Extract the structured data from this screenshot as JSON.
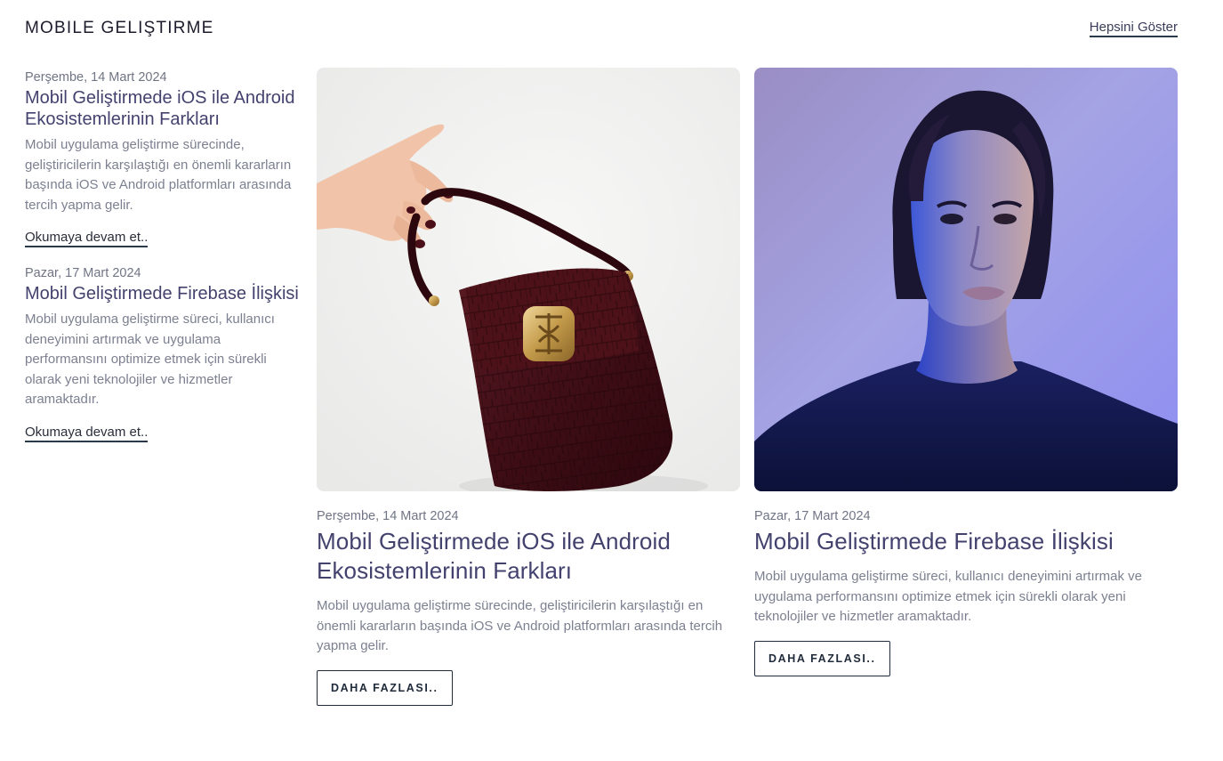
{
  "section": {
    "title": "MOBILE GELIŞTIRME",
    "show_all": "Hepsini Göster"
  },
  "side_posts": [
    {
      "date": "Perşembe, 14 Mart 2024",
      "title": "Mobil Geliştirmede iOS ile Android Ekosistemlerinin Farkları",
      "excerpt": "Mobil uygulama geliştirme sürecinde, geliştiricilerin karşılaştığı en önemli kararların başında iOS ve Android platformları arasında tercih yapma gelir.",
      "read_more": "Okumaya devam et.."
    },
    {
      "date": "Pazar, 17 Mart 2024",
      "title": "Mobil Geliştirmede Firebase İlişkisi",
      "excerpt": "Mobil uygulama geliştirme süreci, kullanıcı deneyimini artırmak ve uygulama performansını optimize etmek için sürekli olarak yeni teknolojiler ve hizmetler aramaktadır.",
      "read_more": "Okumaya devam et.."
    }
  ],
  "cards": [
    {
      "image": "handbag-photo",
      "date": "Perşembe, 14 Mart 2024",
      "title": "Mobil Geliştirmede iOS ile Android Ekosistemlerinin Farkları",
      "excerpt": "Mobil uygulama geliştirme sürecinde, geliştiricilerin karşılaştığı en önemli kararların başında iOS ve Android platformları arasında tercih yapma gelir.",
      "button": "DAHA FAZLASI.."
    },
    {
      "image": "portrait-photo",
      "date": "Pazar, 17 Mart 2024",
      "title": "Mobil Geliştirmede Firebase İlişkisi",
      "excerpt": "Mobil uygulama geliştirme süreci, kullanıcı deneyimini artırmak ve uygulama performansını optimize etmek için sürekli olarak yeni teknolojiler ve hizmetler aramaktadır.",
      "button": "DAHA FAZLASI.."
    }
  ],
  "colors": {
    "title_text": "#43426e",
    "body_text": "#7c8090",
    "border_dark": "#1f2a3a"
  }
}
